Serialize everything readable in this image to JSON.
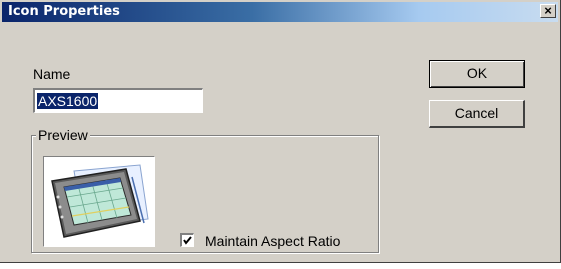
{
  "window": {
    "title": "Icon Properties",
    "close_glyph": "×"
  },
  "fields": {
    "name_label": "Name",
    "name_value": "AXS1600"
  },
  "buttons": {
    "ok_label": "OK",
    "cancel_label": "Cancel"
  },
  "preview": {
    "group_label": "Preview",
    "image": "tablet-device-icon"
  },
  "options": {
    "maintain_aspect_label": "Maintain Aspect Ratio",
    "maintain_aspect_checked": true
  },
  "colors": {
    "dialog_bg": "#d4d0c8",
    "title_start": "#0a246a",
    "title_end": "#a6caf0",
    "selection": "#0a246a"
  }
}
